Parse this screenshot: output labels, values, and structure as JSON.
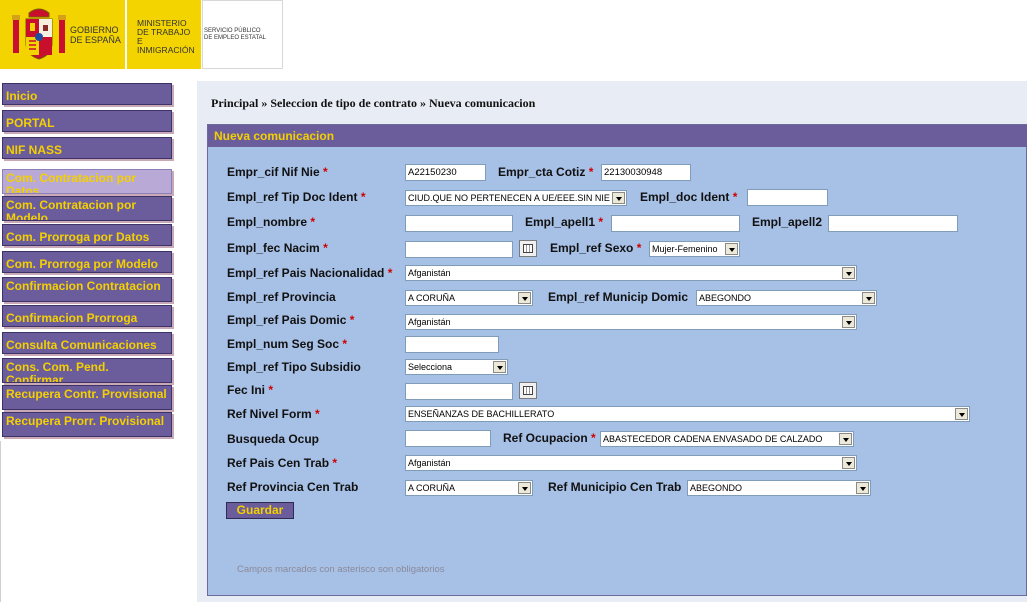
{
  "header": {
    "gobierno": "GOBIERNO\nDE ESPAÑA",
    "ministerio": "MINISTERIO\nDE TRABAJO\nE INMIGRACIÓN",
    "servicio": "SERVICIO PÚBLICO\nDE EMPLEO ESTATAL"
  },
  "sidebar": {
    "items": [
      {
        "label": "Inicio"
      },
      {
        "label": "PORTAL"
      },
      {
        "label": "NIF NASS"
      },
      {
        "label": "Com. Contratacion por Datos"
      },
      {
        "label": "Com. Contratacion por Modelo"
      },
      {
        "label": "Com. Prorroga por Datos"
      },
      {
        "label": "Com. Prorroga por Modelo"
      },
      {
        "label": "Confirmacion Contratacion"
      },
      {
        "label": "Confirmacion Prorroga"
      },
      {
        "label": "Consulta Comunicaciones"
      },
      {
        "label": "Cons. Com. Pend. Confirmar"
      },
      {
        "label": "Recupera Contr. Provisional"
      },
      {
        "label": "Recupera Prorr. Provisional"
      }
    ]
  },
  "breadcrumb": "Principal » Seleccion de tipo de contrato » Nueva comunicacion",
  "form": {
    "title": "Nueva comunicacion",
    "asterisk": "*",
    "fields": {
      "empr_cif": {
        "label": "Empr_cif Nif Nie",
        "value": "A22150230"
      },
      "empr_cta": {
        "label": "Empr_cta Cotiz",
        "value": "22130030948"
      },
      "tip_doc": {
        "label": "Empl_ref Tip Doc Ident",
        "value": "CIUD.QUE NO PERTENECEN A UE/EEE.SIN NIE"
      },
      "doc_ident": {
        "label": "Empl_doc Ident",
        "value": ""
      },
      "nombre": {
        "label": "Empl_nombre",
        "value": ""
      },
      "apell1": {
        "label": "Empl_apell1",
        "value": ""
      },
      "apell2": {
        "label": "Empl_apell2",
        "value": ""
      },
      "fec_nacim": {
        "label": "Empl_fec Nacim",
        "value": ""
      },
      "sexo": {
        "label": "Empl_ref Sexo",
        "value": "Mujer-Femenino"
      },
      "pais_nac": {
        "label": "Empl_ref Pais Nacionalidad",
        "value": "Afganistán"
      },
      "provincia": {
        "label": "Empl_ref Provincia",
        "value": "A CORUÑA"
      },
      "municip": {
        "label": "Empl_ref Municip Domic",
        "value": "ABEGONDO"
      },
      "pais_domic": {
        "label": "Empl_ref Pais Domic",
        "value": "Afganistán"
      },
      "seg_soc": {
        "label": "Empl_num Seg Soc",
        "value": ""
      },
      "subsidio": {
        "label": "Empl_ref Tipo Subsidio",
        "value": "Selecciona"
      },
      "fec_ini": {
        "label": "Fec Ini",
        "value": ""
      },
      "nivel_form": {
        "label": "Ref Nivel Form",
        "value": "ENSEÑANZAS DE BACHILLERATO"
      },
      "busq_ocup": {
        "label": "Busqueda Ocup",
        "value": ""
      },
      "ocupacion": {
        "label": "Ref Ocupacion",
        "value": "ABASTECEDOR CADENA ENVASADO DE CALZADO"
      },
      "pais_cen": {
        "label": "Ref Pais Cen Trab",
        "value": "Afganistán"
      },
      "prov_cen": {
        "label": "Ref Provincia Cen Trab",
        "value": "A CORUÑA"
      },
      "munic_cen": {
        "label": "Ref Municipio Cen Trab",
        "value": "ABEGONDO"
      }
    },
    "save_label": "Guardar",
    "footnote": "Campos marcados con asterisco son obligatorios"
  },
  "colors": {
    "accent": "#6b5d9c",
    "accent_text": "#f5d000",
    "panel": "#a7c0e6",
    "header_yellow": "#f3d400",
    "required": "#d00000"
  },
  "icons": {
    "calendar": "calendar-icon",
    "dropdown": "chevron-down-icon",
    "coat_of_arms": "coat-of-arms-icon"
  }
}
